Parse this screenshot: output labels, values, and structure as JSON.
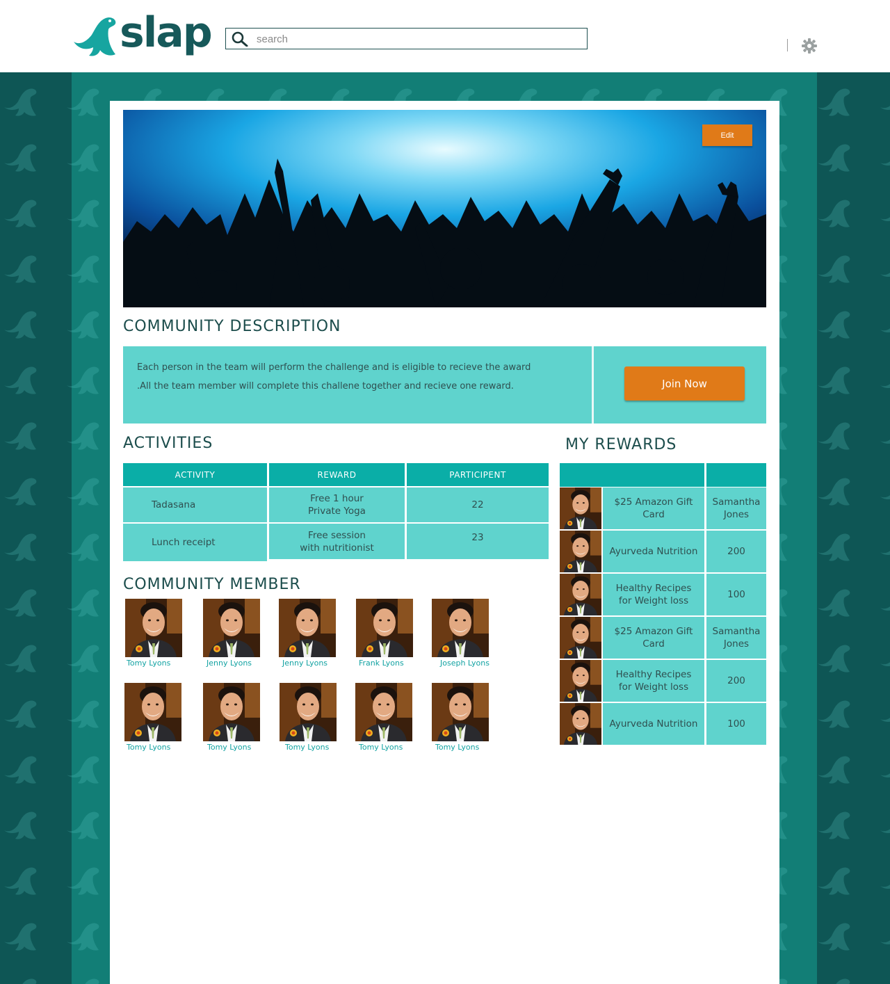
{
  "header": {
    "logo_text": "slap",
    "search_placeholder": "search"
  },
  "banner": {
    "edit_label": "Edit"
  },
  "community_description": {
    "title": "COMMUNITY DESCRIPTION",
    "text": "Each person in the team will perform the challenge and is eligible to recieve the award .All the team member will complete this challene together and recieve one reward.",
    "join_label": "Join Now"
  },
  "activities": {
    "title": "ACTIVITIES",
    "columns": [
      "ACTIVITY",
      "REWARD",
      "PARTICIPENT"
    ],
    "rows": [
      {
        "activity": "Tadasana",
        "reward": "Free 1 hour\nPrivate Yoga",
        "participants": "22"
      },
      {
        "activity": "Lunch receipt",
        "reward": "Free session\nwith nutritionist",
        "participants": "23"
      }
    ]
  },
  "members": {
    "title": "COMMUNITY MEMBER",
    "items": [
      {
        "name": "Tomy Lyons"
      },
      {
        "name": "Jenny Lyons"
      },
      {
        "name": "Jenny Lyons"
      },
      {
        "name": "Frank Lyons"
      },
      {
        "name": "Joseph Lyons"
      },
      {
        "name": "Tomy Lyons"
      },
      {
        "name": "Tomy Lyons"
      },
      {
        "name": "Tomy Lyons"
      },
      {
        "name": "Tomy Lyons"
      },
      {
        "name": "Tomy Lyons"
      }
    ]
  },
  "rewards": {
    "title": "MY REWARDS",
    "rows": [
      {
        "reward": "$25 Amazon Gift\nCard",
        "value": "Samantha\nJones"
      },
      {
        "reward": "Ayurveda Nutrition",
        "value": "200"
      },
      {
        "reward": "Healthy Recipes\nfor Weight loss",
        "value": "100"
      },
      {
        "reward": "$25 Amazon Gift\nCard",
        "value": "Samantha\nJones"
      },
      {
        "reward": "Healthy Recipes\nfor Weight loss",
        "value": "200"
      },
      {
        "reward": "Ayurveda Nutrition",
        "value": "100"
      }
    ]
  },
  "colors": {
    "brand_dark": "#17595a",
    "accent_orange": "#e07a18",
    "teal_header": "#0aaea7",
    "teal_cell": "#5fd3cd",
    "link_teal": "#12a2a2"
  },
  "icons": {
    "search": "magnifier-icon",
    "settings": "gear-icon",
    "logo": "seal-logo-icon"
  }
}
